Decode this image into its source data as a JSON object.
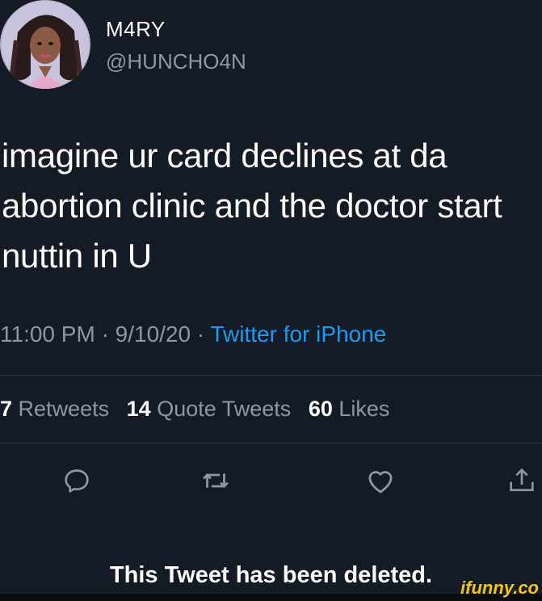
{
  "author": {
    "display_name": "M4RY",
    "handle": "@HUNCHO4N"
  },
  "tweet": {
    "text": "imagine ur card declines at da abortion clinic and the doctor start nuttin in U",
    "time": "11:00 PM",
    "date": "9/10/20",
    "separator": "·",
    "source": "Twitter for iPhone"
  },
  "stats": {
    "retweets_count": "7",
    "retweets_label": "Retweets",
    "quotes_count": "14",
    "quotes_label": "Quote Tweets",
    "likes_count": "60",
    "likes_label": "Likes"
  },
  "actions": [
    {
      "icon": "reply-icon"
    },
    {
      "icon": "retweet-icon"
    },
    {
      "icon": "like-icon"
    },
    {
      "icon": "share-icon"
    }
  ],
  "notice": {
    "deleted_text": "This Tweet has been deleted."
  },
  "watermark": {
    "text": "ifunny.co"
  },
  "colors": {
    "background": "#141b24",
    "text_primary": "#ffffff",
    "text_secondary": "#8b98a5",
    "link": "#1d9bf0",
    "watermark": "#f5c518"
  }
}
